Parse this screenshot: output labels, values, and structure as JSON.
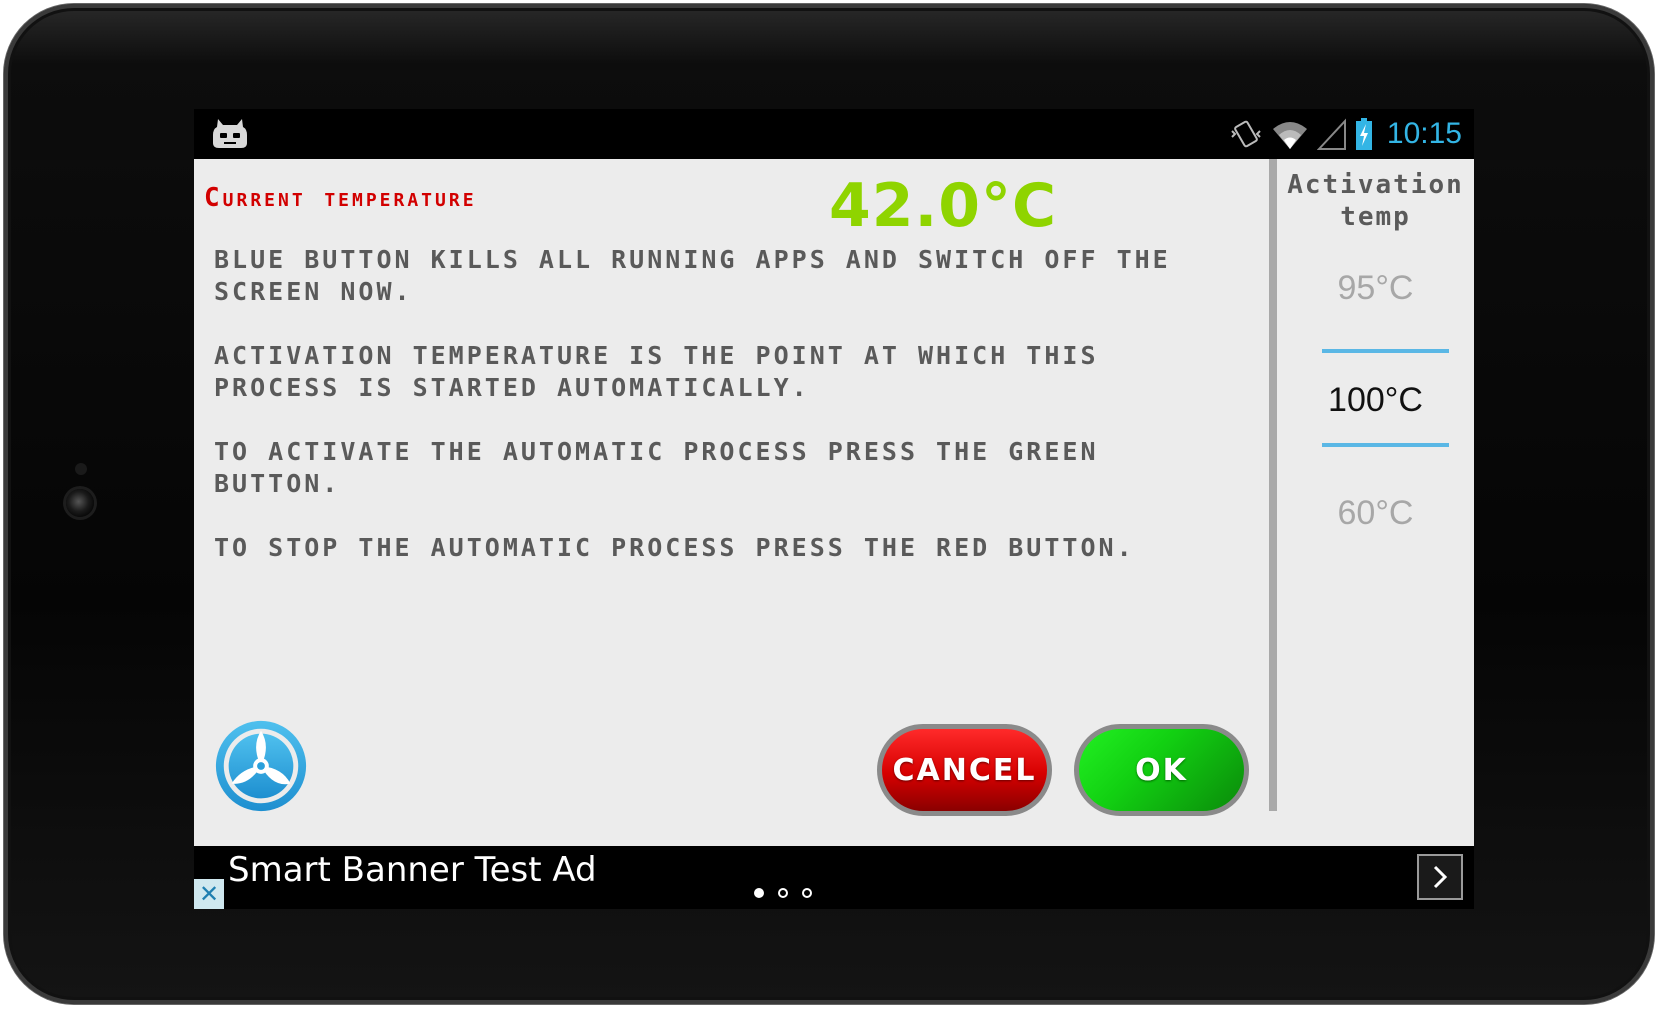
{
  "status_bar": {
    "time": "10:15",
    "icons": [
      "cyanogen-mod-icon",
      "vibrate-icon",
      "wifi-icon",
      "signal-icon",
      "battery-charging-icon"
    ]
  },
  "main": {
    "current_label": "Current temperature",
    "current_value": "42.0°C",
    "instructions": [
      "Blue button kills all running apps and switch off the screen now.",
      "Activation temperature is the point at which this process is started automatically.",
      "To activate the automatic process press the green button.",
      "To stop the automatic process press the red button."
    ],
    "cancel_label": "CANCEL",
    "ok_label": "OK"
  },
  "picker": {
    "title": "Activation temp",
    "above": "95°C",
    "selected": "100°C",
    "below": "60°C"
  },
  "ad": {
    "text": "Smart Banner Test Ad",
    "close_symbol": "✕",
    "active_page": 1,
    "page_count": 3
  },
  "colors": {
    "current_label": "#d20000",
    "current_value": "#8fd400",
    "time": "#33b5e5",
    "picker_line": "#5ab7e5",
    "cancel_button": "#d60000",
    "ok_button": "#12d012"
  }
}
